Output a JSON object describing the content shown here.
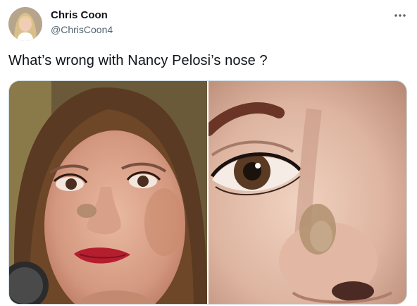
{
  "author": {
    "name": "Chris Coon",
    "handle": "@ChrisCoon4"
  },
  "tweet": {
    "text": "What’s wrong with Nancy Pelosi’s nose ?"
  },
  "icons": {
    "more": "more-horizontal-icon"
  },
  "media": {
    "photos": [
      "face-closeup-photo",
      "eye-and-nose-closeup-photo"
    ]
  }
}
